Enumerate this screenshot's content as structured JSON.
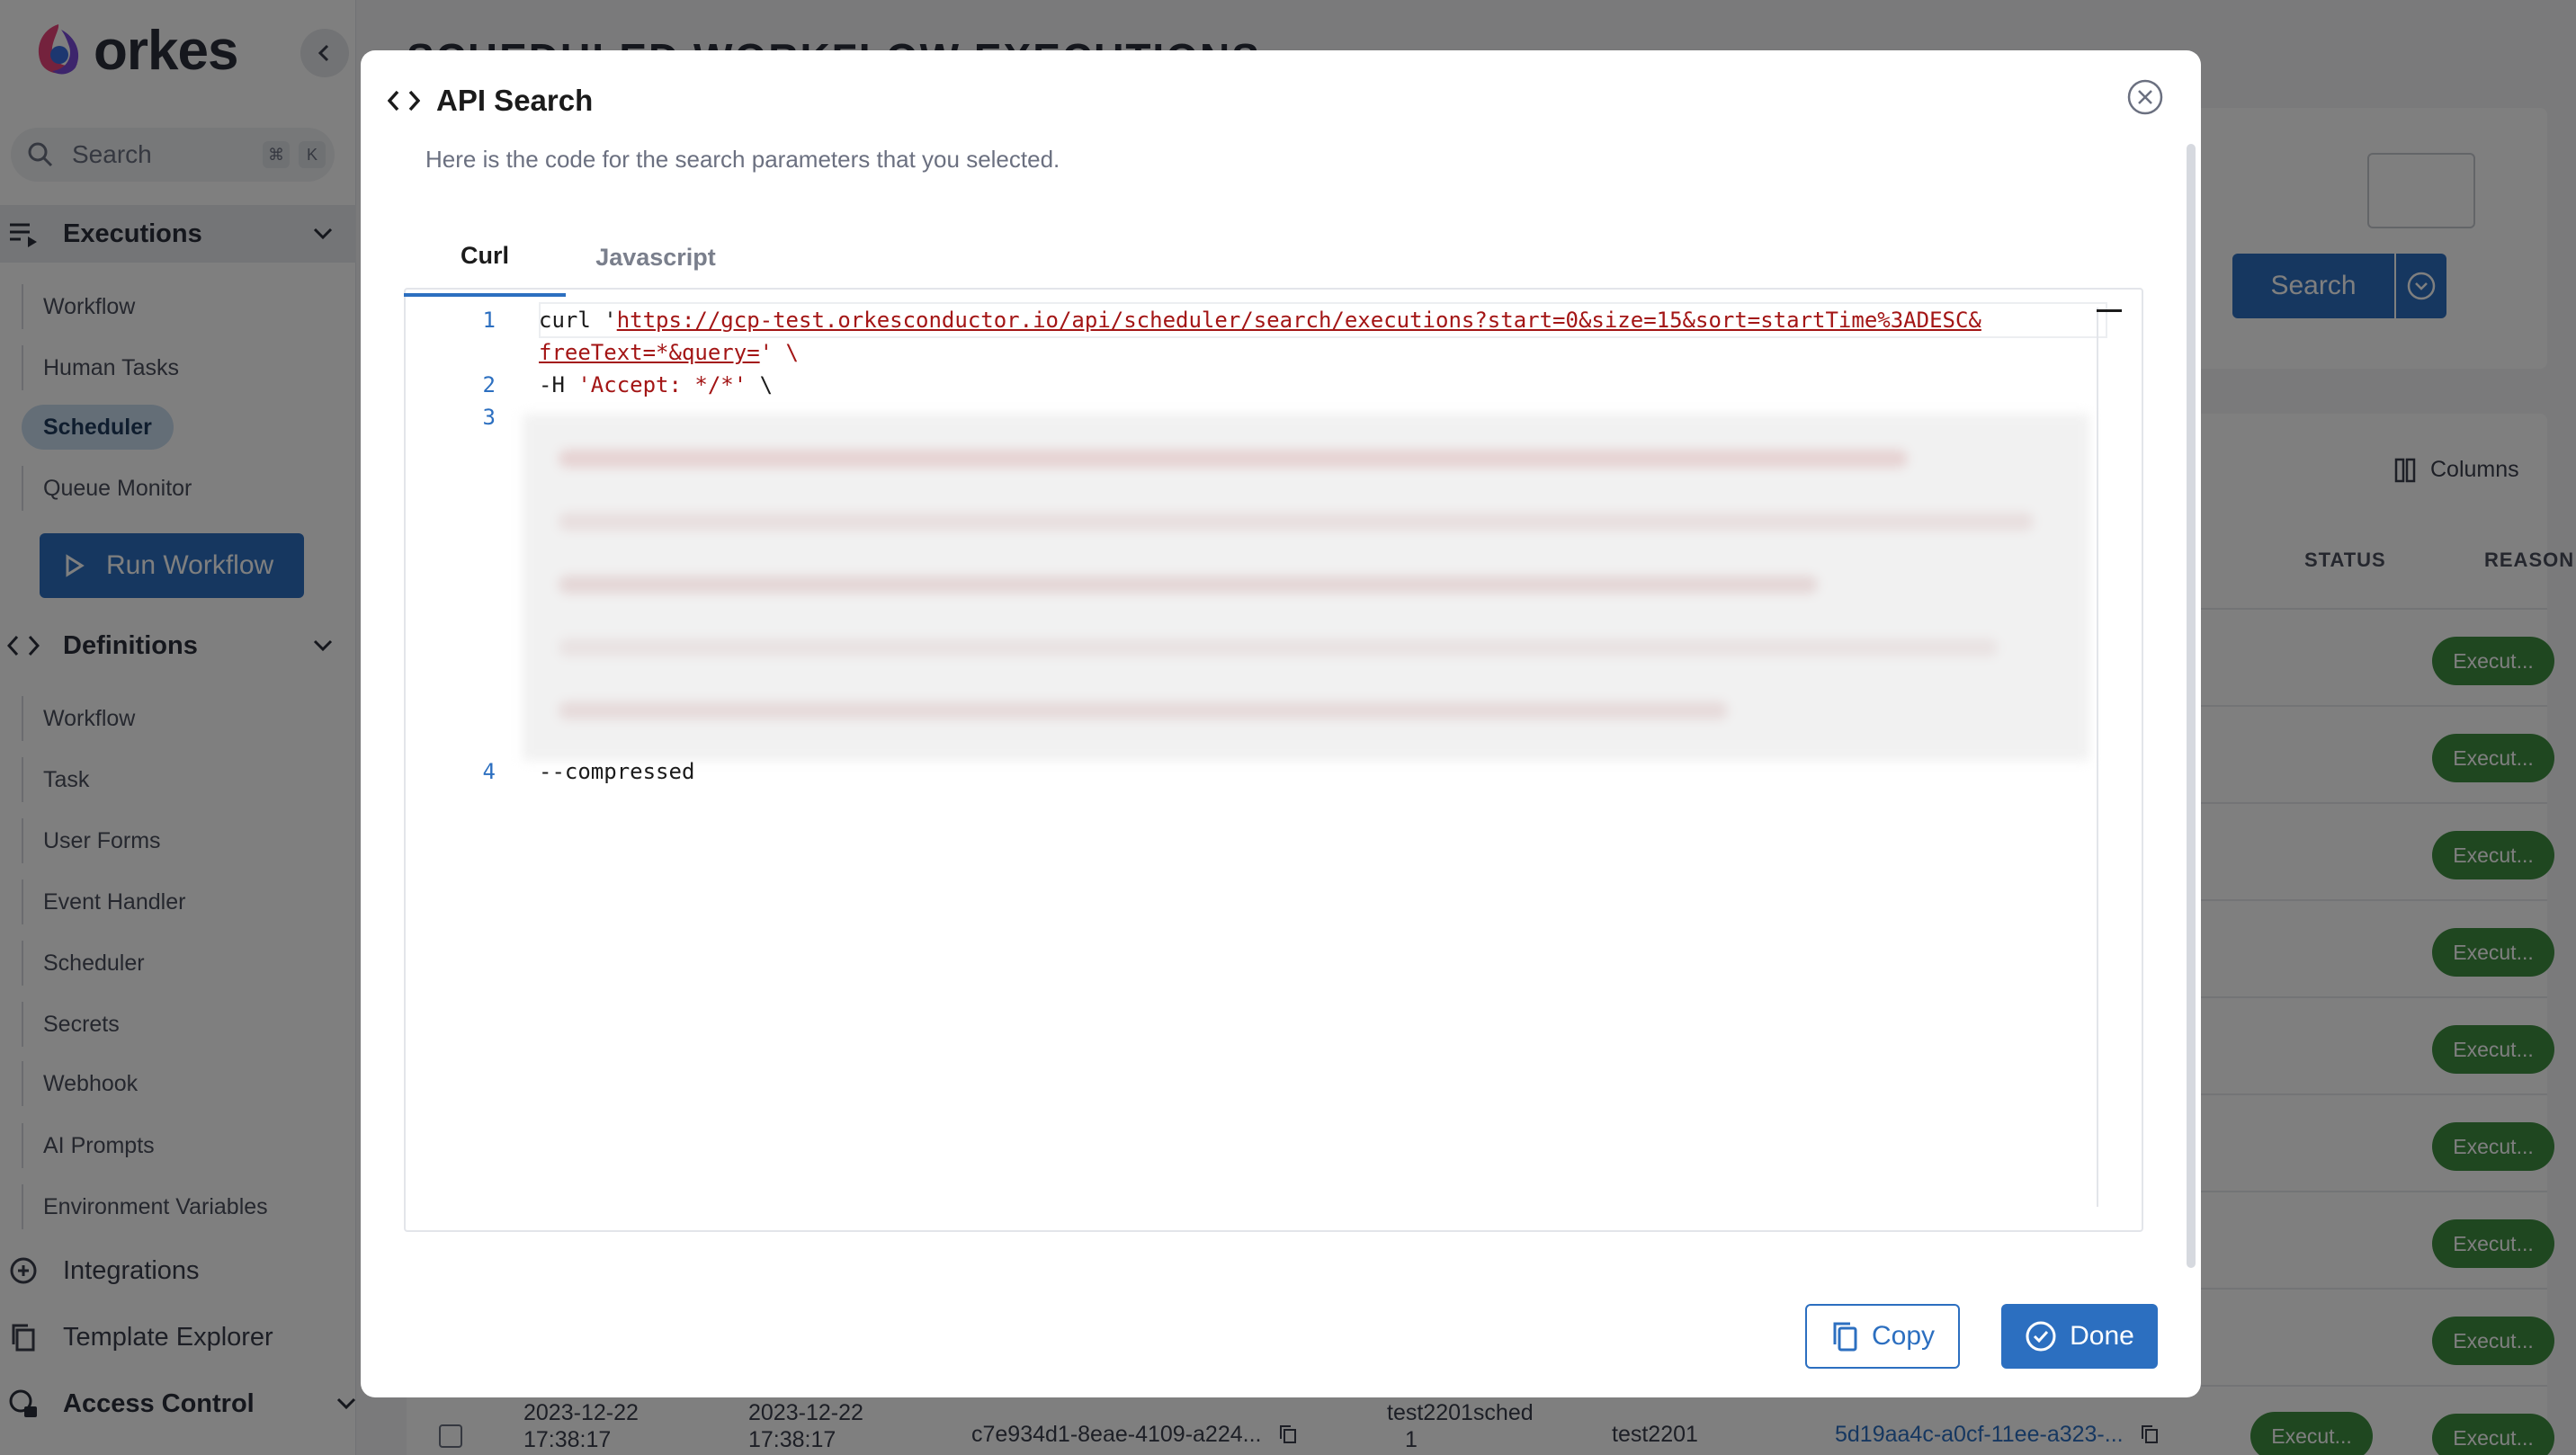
{
  "sidebar": {
    "logo_text": "orkes",
    "search_label": "Search",
    "search_shortcut": [
      "⌘",
      "K"
    ],
    "sections": {
      "executions": {
        "label": "Executions",
        "items": [
          "Workflow",
          "Human Tasks",
          "Scheduler",
          "Queue Monitor"
        ],
        "selected": "Scheduler"
      },
      "run_workflow_label": "Run Workflow",
      "definitions": {
        "label": "Definitions",
        "items": [
          "Workflow",
          "Task",
          "User Forms",
          "Event Handler",
          "Scheduler",
          "Secrets",
          "Webhook",
          "AI Prompts",
          "Environment Variables"
        ]
      },
      "bottom": [
        "Integrations",
        "Template Explorer",
        "Access Control"
      ]
    }
  },
  "main": {
    "page_title": "SCHEDULED WORKFLOW EXECUTIONS",
    "search_button": "Search",
    "columns_button": "Columns",
    "table_headers": [
      "STATUS",
      "REASON"
    ],
    "status_chips": [
      "Execut...",
      "Execut...",
      "Execut...",
      "Execut...",
      "Execut...",
      "Execut...",
      "Execut...",
      "Execut...",
      "Execut..."
    ],
    "last_row": {
      "col1": [
        "2023-12-22",
        "17:38:17"
      ],
      "col2": [
        "2023-12-22",
        "17:38:17"
      ],
      "id": "c7e934d1-8eae-4109-a224...",
      "name": [
        "test2201sched",
        "1"
      ],
      "workflow": "test2201",
      "execution": "5d19aa4c-a0cf-11ee-a323-..."
    }
  },
  "modal": {
    "title": "API Search",
    "subtitle": "Here is the code for the search parameters that you selected.",
    "tabs": [
      "Curl",
      "Javascript"
    ],
    "active_tab": "Curl",
    "code": {
      "line1_prefix": "curl '",
      "line1_url": "https://gcp-test.orkesconductor.io/api/scheduler/search/executions?start=0&size=15&sort=startTime%3ADESC&",
      "line1b_url": "freeText=*&query=",
      "line1b_suffix": "' \\",
      "line2_prefix": "-H ",
      "line2_str": "'Accept: */*'",
      "line2_suffix": " \\",
      "line4": "--compressed",
      "line_numbers": [
        "1",
        "2",
        "3",
        "4"
      ]
    },
    "copy_label": "Copy",
    "done_label": "Done"
  },
  "colors": {
    "primary": "#2c6fc0",
    "status_green": "#3e8e41",
    "string_red": "#a31515"
  }
}
